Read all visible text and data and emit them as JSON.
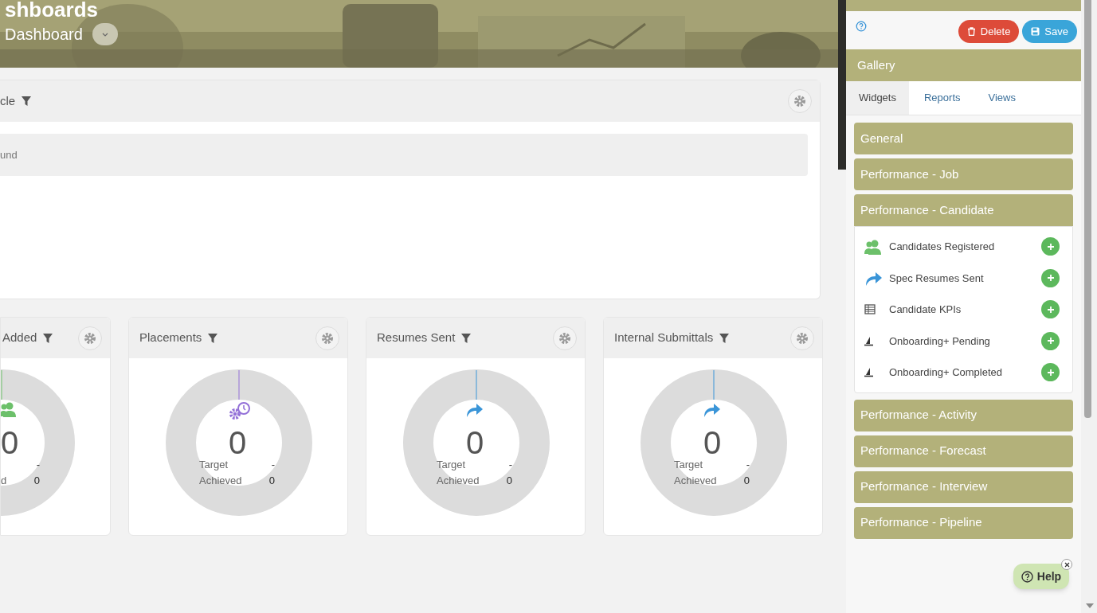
{
  "header": {
    "title": "shboards",
    "subtitle": "Dashboard"
  },
  "top_widget": {
    "title": "cle",
    "message": "und"
  },
  "widgets": [
    {
      "kind": "people",
      "title": "Added",
      "value": "0",
      "target_value": "-",
      "achieved_label": "d",
      "achieved_value": "0"
    },
    {
      "kind": "gears-clock",
      "title": "Placements",
      "value": "0",
      "target_label": "Target",
      "target_value": "-",
      "achieved_label": "Achieved",
      "achieved_value": "0"
    },
    {
      "kind": "share",
      "title": "Resumes Sent",
      "value": "0",
      "target_label": "Target",
      "target_value": "-",
      "achieved_label": "Achieved",
      "achieved_value": "0"
    },
    {
      "kind": "share",
      "title": "Internal Submittals",
      "value": "0",
      "target_label": "Target",
      "target_value": "-",
      "achieved_label": "Achieved",
      "achieved_value": "0"
    }
  ],
  "sidebar": {
    "buttons": [
      {
        "kind": "delete",
        "label": "Delete"
      },
      {
        "kind": "save",
        "label": "Save"
      }
    ],
    "gallery_title": "Gallery",
    "tabs": [
      {
        "label": "Widgets",
        "selected": true
      },
      {
        "label": "Reports",
        "selected": false
      },
      {
        "label": "Views",
        "selected": false
      }
    ],
    "groups": [
      {
        "label": "General",
        "expanded": false
      },
      {
        "label": "Performance - Job",
        "expanded": false
      },
      {
        "label": "Performance - Candidate",
        "expanded": true,
        "items": [
          {
            "kind": "people",
            "label": "Candidates Registered"
          },
          {
            "kind": "share",
            "label": "Spec Resumes Sent"
          },
          {
            "kind": "table",
            "label": "Candidate KPIs"
          },
          {
            "kind": "sail",
            "label": "Onboarding+ Pending"
          },
          {
            "kind": "sail",
            "label": "Onboarding+ Completed"
          }
        ]
      },
      {
        "label": "Performance - Activity",
        "expanded": false
      },
      {
        "label": "Performance - Forecast",
        "expanded": false
      },
      {
        "label": "Performance - Interview",
        "expanded": false
      },
      {
        "label": "Performance - Pipeline",
        "expanded": false
      }
    ],
    "help": {
      "label": "Help"
    }
  }
}
